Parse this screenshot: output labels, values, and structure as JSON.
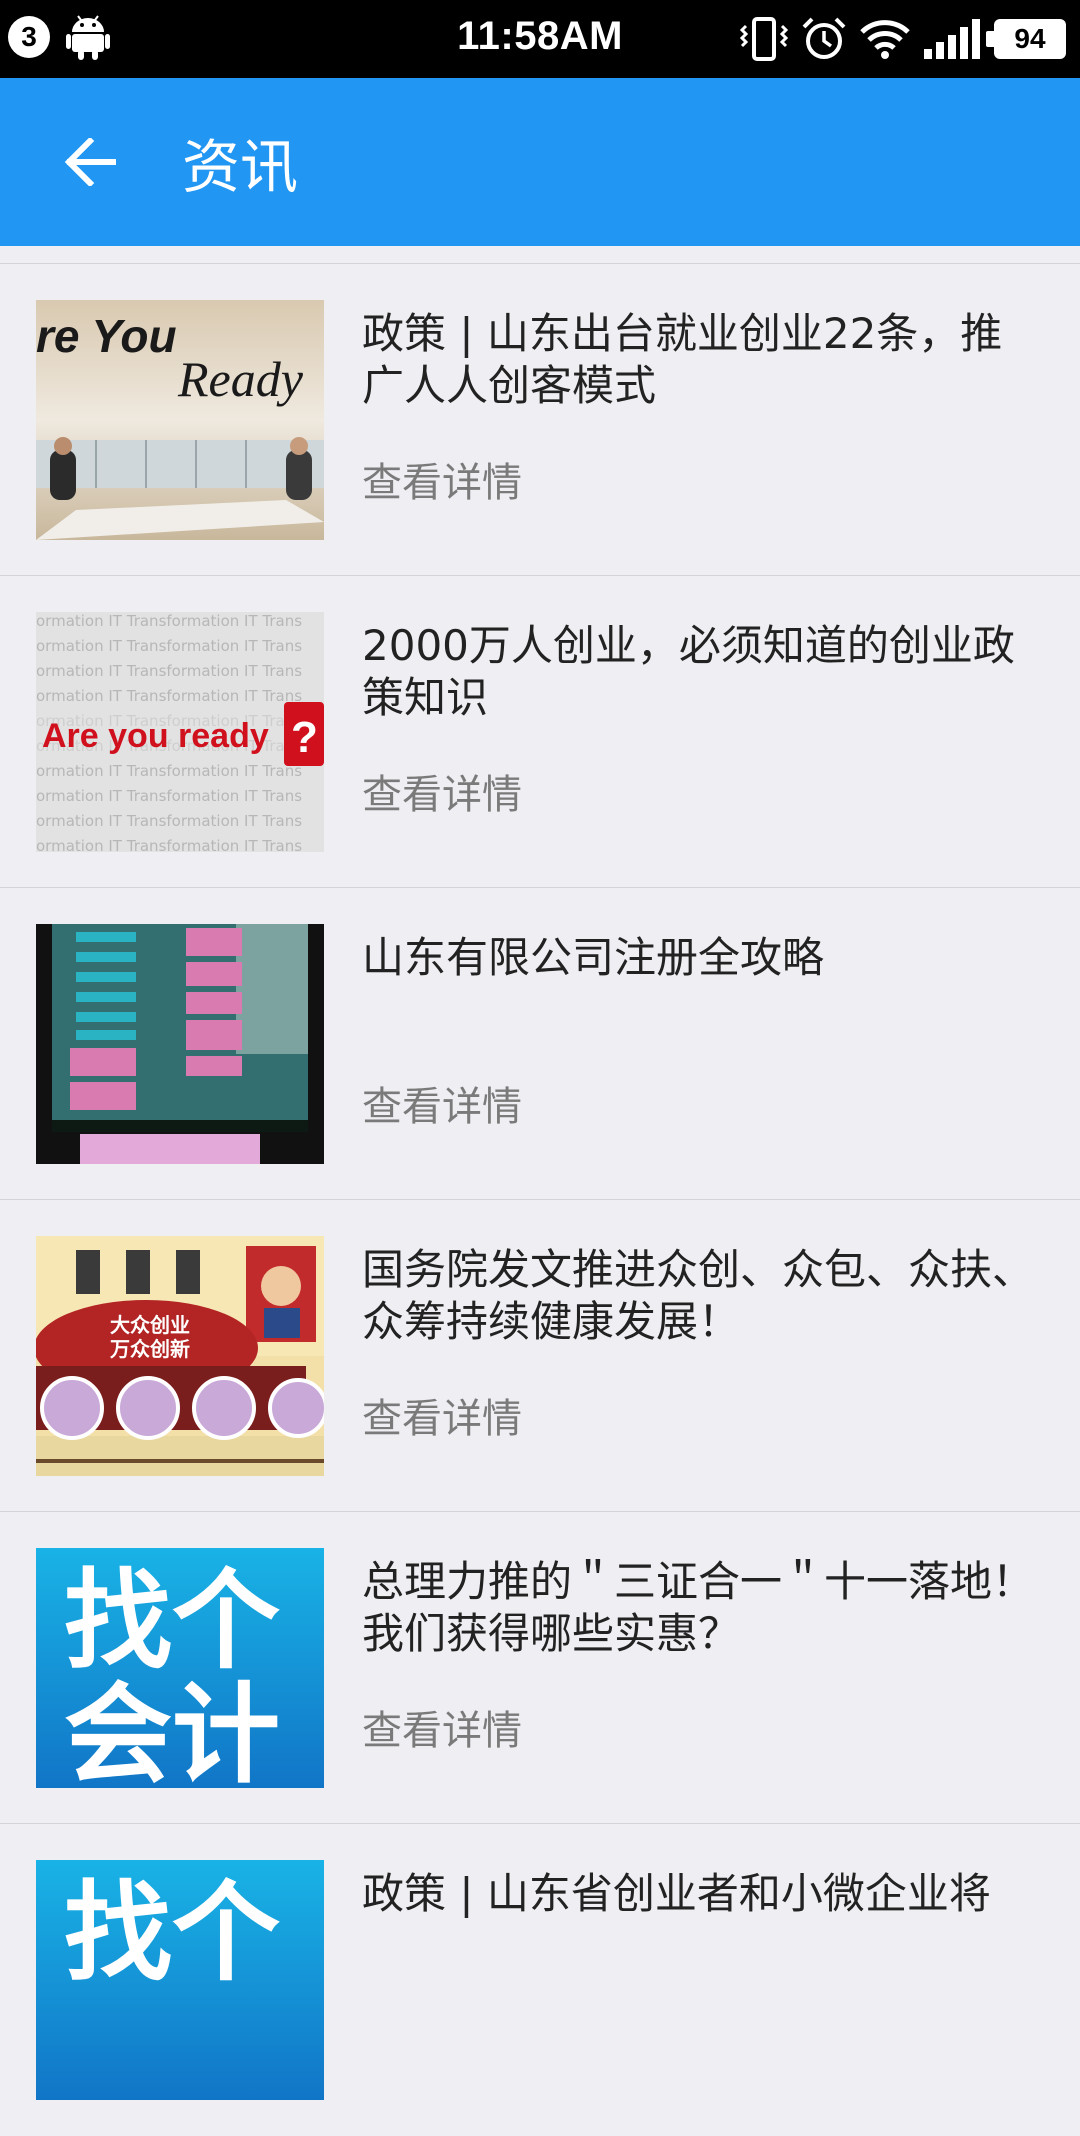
{
  "status_bar": {
    "notification_count": "3",
    "time": "11:58AM",
    "battery": "94"
  },
  "app_bar": {
    "title": "资讯"
  },
  "thumbnail_texts": {
    "item1": [
      "re You",
      "Ready"
    ],
    "item2": [
      "Are you ready",
      "?",
      "ormation   IT Transformation   IT Trans"
    ],
    "item4": [
      "大众创业",
      "万众创新"
    ],
    "item5": [
      "找个",
      "会计"
    ],
    "item6": [
      "找个"
    ]
  },
  "news_items": [
    {
      "title": "政策 | 山东出台就业创业22条，推广人人创客模式",
      "link": "查看详情"
    },
    {
      "title": "2000万人创业，必须知道的创业政策知识",
      "link": "查看详情"
    },
    {
      "title": "山东有限公司注册全攻略",
      "link": "查看详情"
    },
    {
      "title": "国务院发文推进众创、众包、众扶、众筹持续健康发展！",
      "link": "查看详情"
    },
    {
      "title": "总理力推的＂三证合一＂十一落地！我们获得哪些实惠？",
      "link": "查看详情"
    },
    {
      "title": "政策 | 山东省创业者和小微企业将",
      "link": ""
    }
  ]
}
